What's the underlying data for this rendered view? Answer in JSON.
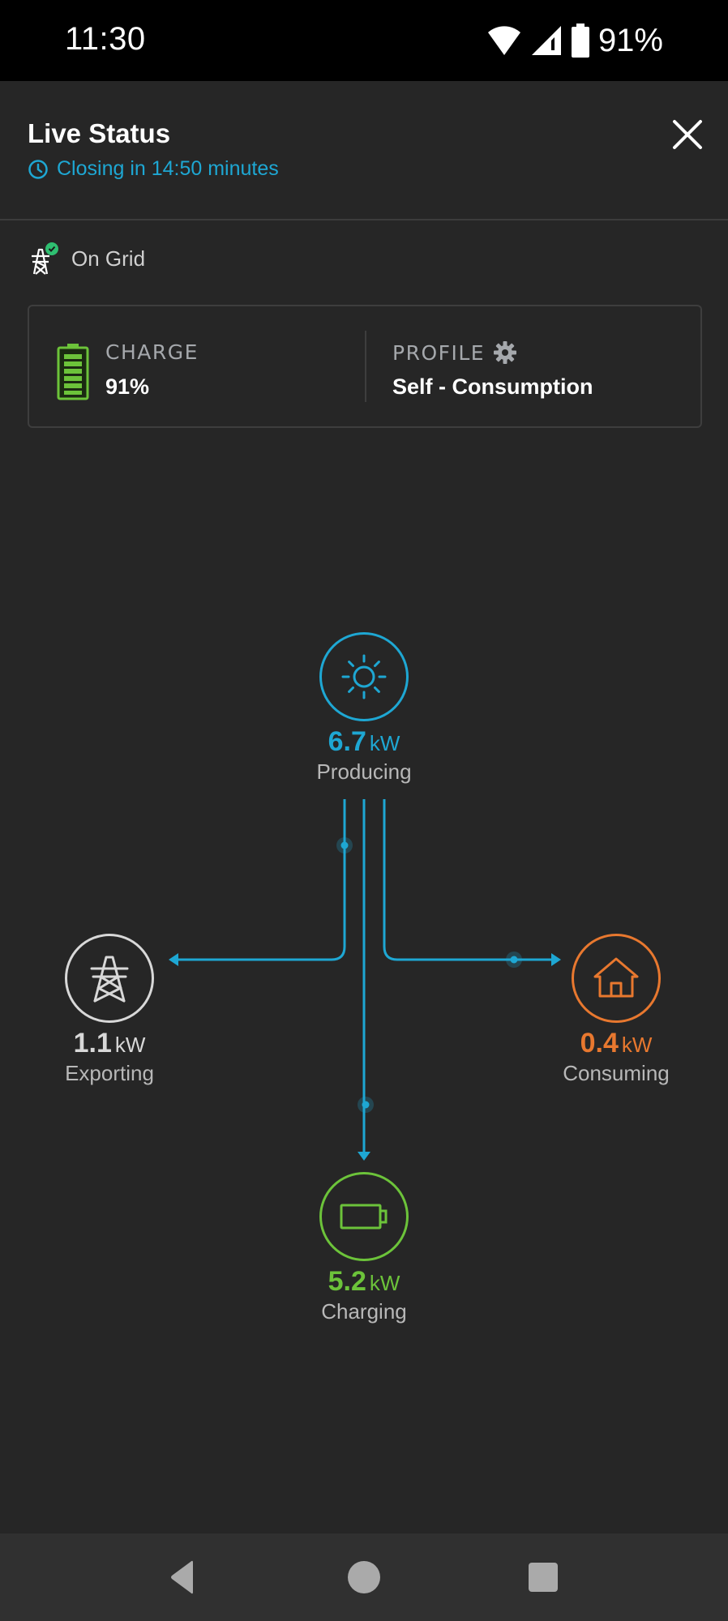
{
  "status_bar": {
    "time": "11:30",
    "battery_percent": "91%",
    "icons": [
      "wifi-icon",
      "cellular-signal-icon",
      "battery-icon"
    ]
  },
  "header": {
    "title": "Live Status",
    "subtitle": "Closing in 14:50 minutes",
    "subtitle_icon": "clock-icon",
    "close_icon": "close-icon"
  },
  "grid_status": {
    "label": "On Grid",
    "icon": "grid-tower-check-icon"
  },
  "summary_card": {
    "charge_label": "CHARGE",
    "charge_value": "91%",
    "charge_level_percent": 91,
    "profile_label": "PROFILE",
    "profile_value": "Self - Consumption"
  },
  "power_flow": {
    "solar": {
      "value": "6.7",
      "unit": "kW",
      "caption": "Producing",
      "icon": "sun-icon",
      "color": "#1ea7d3"
    },
    "grid": {
      "value": "1.1",
      "unit": "kW",
      "caption": "Exporting",
      "icon": "power-tower-icon",
      "color": "#d8d8d8"
    },
    "home": {
      "value": "0.4",
      "unit": "kW",
      "caption": "Consuming",
      "icon": "house-icon",
      "color": "#e8782f"
    },
    "battery": {
      "value": "5.2",
      "unit": "kW",
      "caption": "Charging",
      "icon": "battery-icon",
      "color": "#6cc33a"
    },
    "flow_color": "#1ea7d3"
  },
  "nav_bar": {
    "back": "back-icon",
    "home": "home-icon",
    "recents": "recents-icon"
  }
}
